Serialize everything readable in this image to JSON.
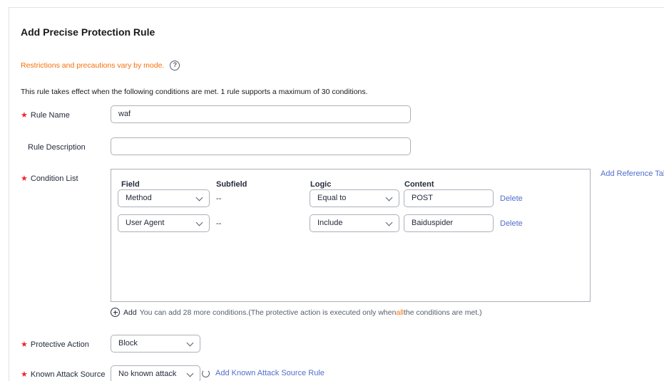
{
  "title": "Add Precise Protection Rule",
  "notice": "Restrictions and precautions vary by mode.",
  "help_icon": "?",
  "rule_info": "This rule takes effect when the following conditions are met. 1 rule supports a maximum of 30 conditions.",
  "required_mark": "★",
  "rule_name": {
    "label": "Rule Name",
    "value": "waf"
  },
  "rule_description": {
    "label": "Rule Description",
    "value": ""
  },
  "condition_list": {
    "label": "Condition List",
    "add_reference_table": "Add Reference Table",
    "headers": {
      "field": "Field",
      "subfield": "Subfield",
      "logic": "Logic",
      "content": "Content"
    },
    "rows": [
      {
        "field": "Method",
        "subfield": "--",
        "logic": "Equal to",
        "content": "POST",
        "action": "Delete"
      },
      {
        "field": "User Agent",
        "subfield": "--",
        "logic": "Include",
        "content": "Baiduspider",
        "action": "Delete"
      }
    ],
    "add_label": "Add",
    "add_hint_prefix": "You can add 28 more conditions.(The protective action is executed only when ",
    "add_hint_highlight": "all",
    "add_hint_suffix": " the conditions are met.)"
  },
  "protective_action": {
    "label": "Protective Action",
    "value": "Block"
  },
  "known_attack_source": {
    "label": "Known Attack Source",
    "value": "No known attack",
    "link": "Add Known Attack Source Rule"
  }
}
